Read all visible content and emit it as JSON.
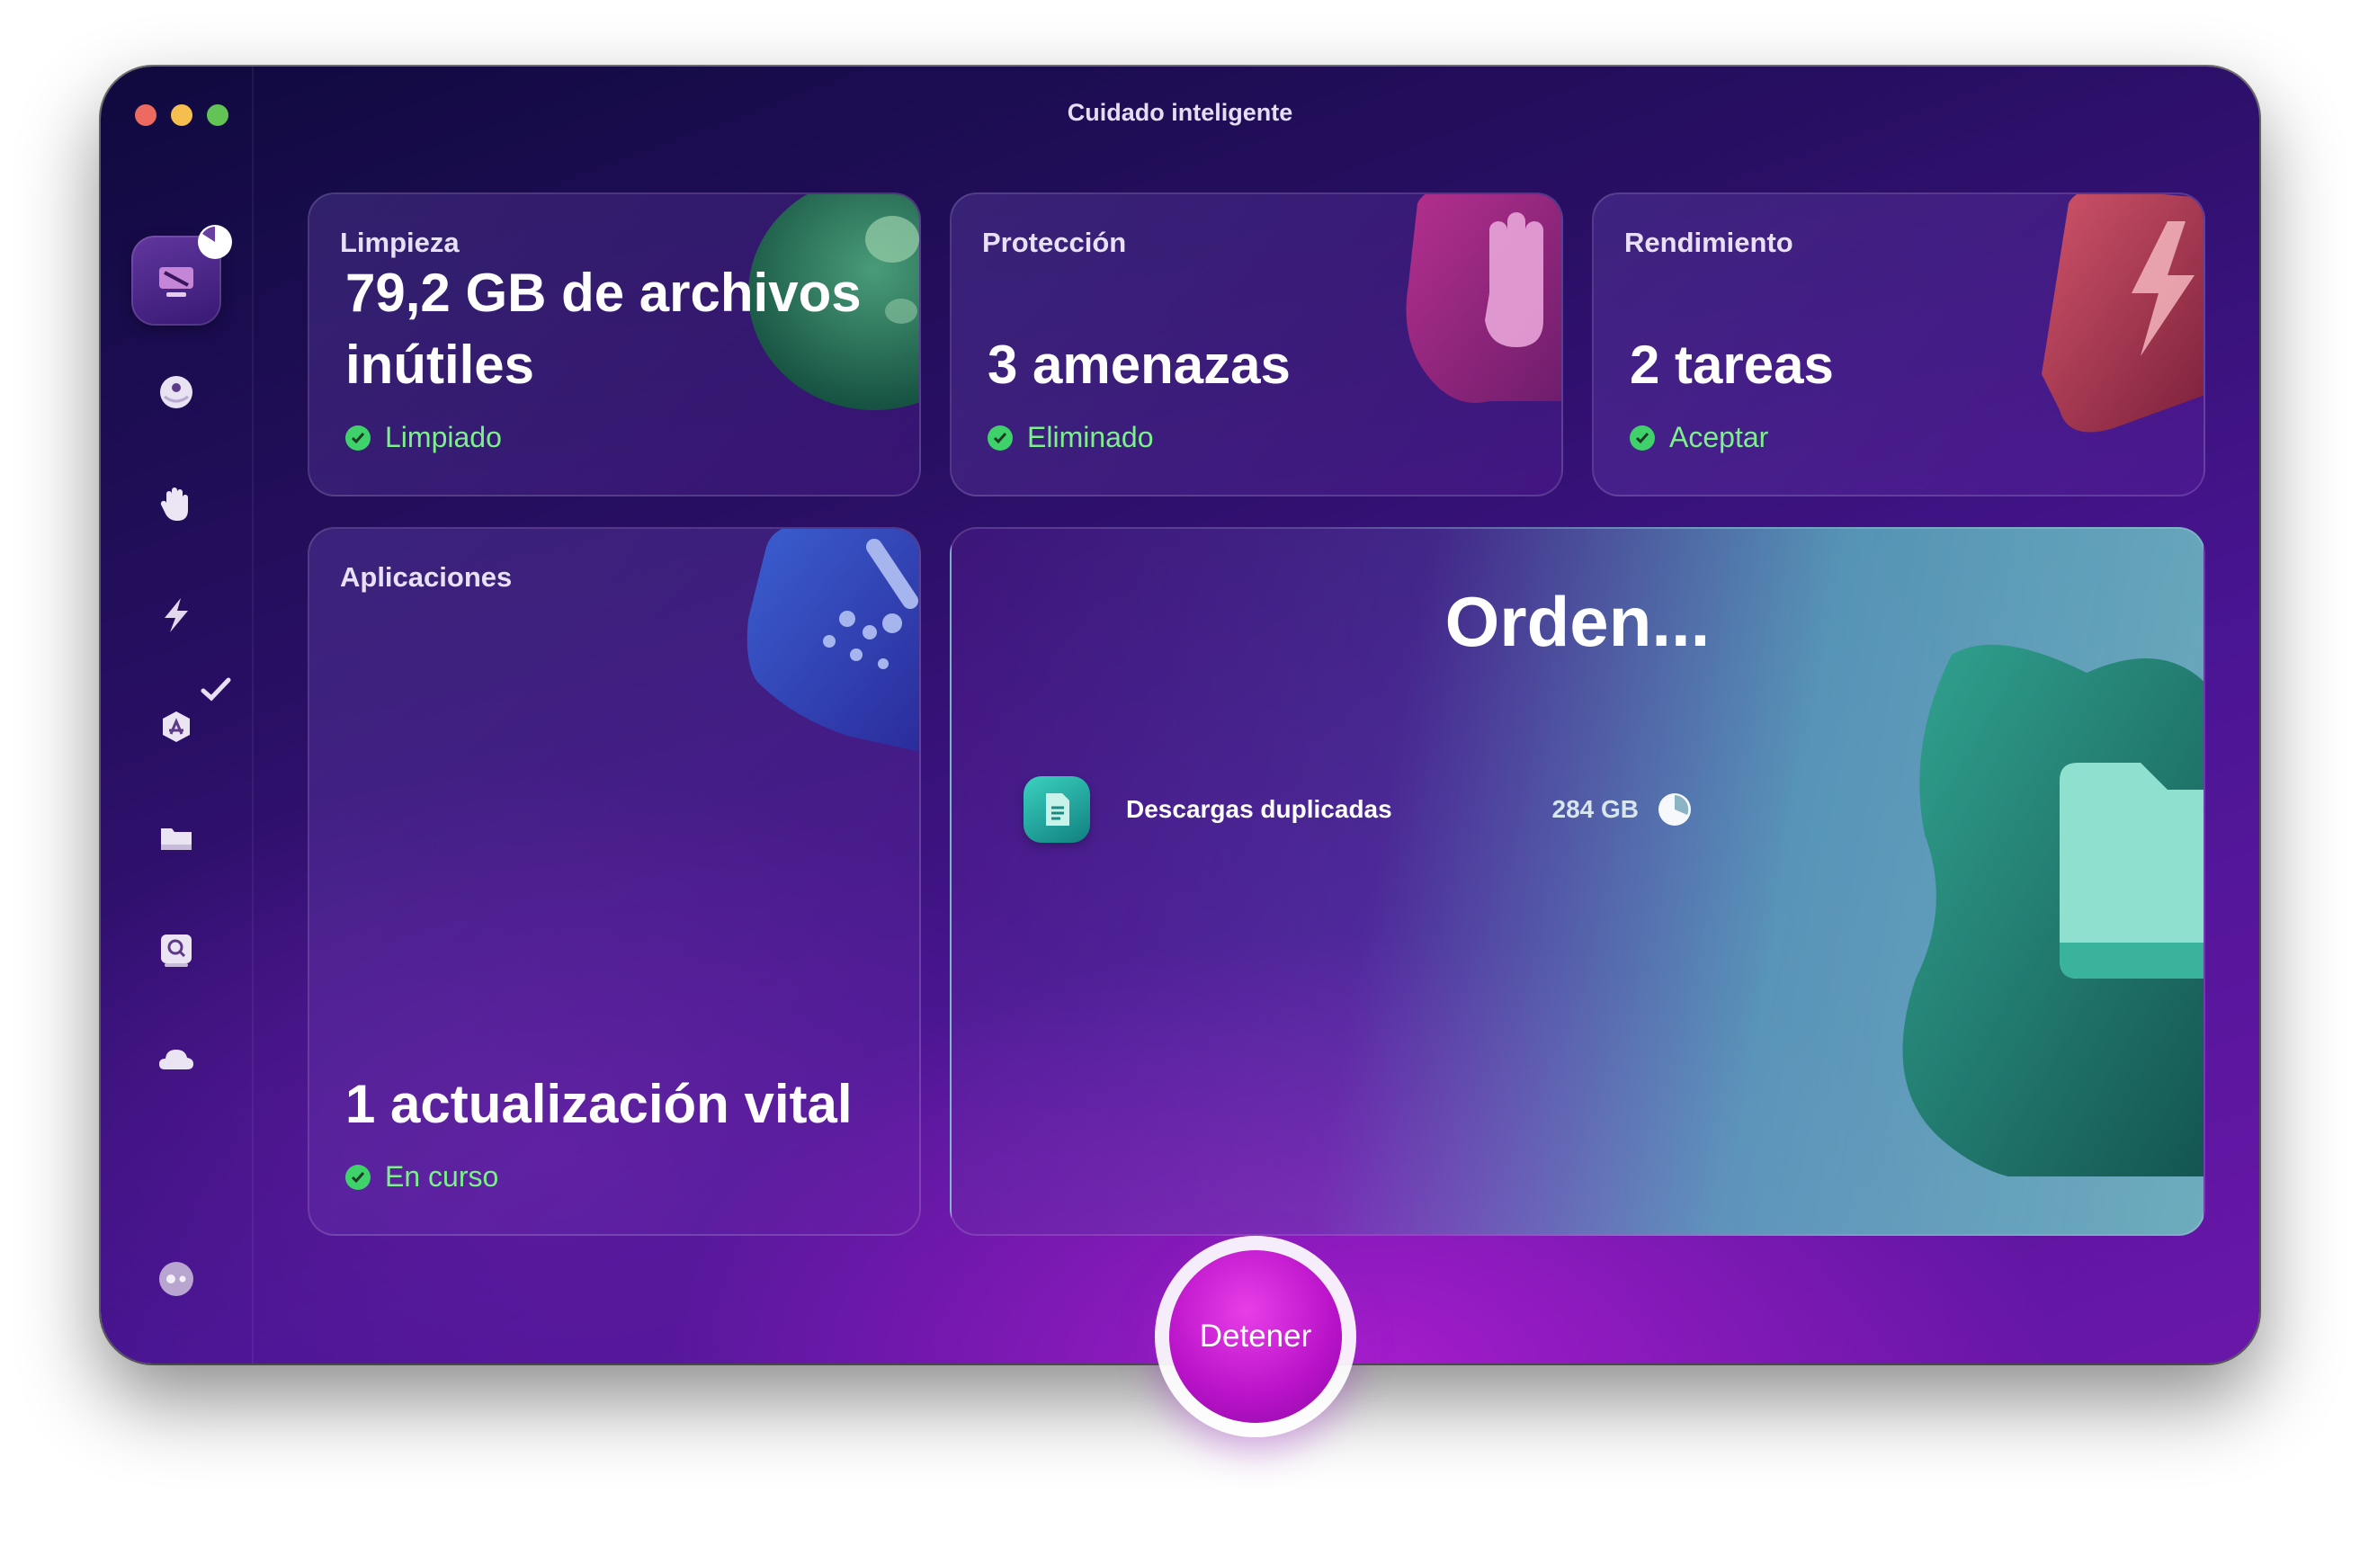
{
  "window": {
    "title": "Cuidado inteligente"
  },
  "sidebar": {
    "items": [
      {
        "name": "smart-care",
        "icon": "monitor-icon",
        "active": true
      },
      {
        "name": "cleanup",
        "icon": "disc-icon"
      },
      {
        "name": "protection",
        "icon": "hand-icon"
      },
      {
        "name": "performance",
        "icon": "lightning-icon"
      },
      {
        "name": "applications",
        "icon": "app-store-icon"
      },
      {
        "name": "my-clutter",
        "icon": "folder-icon"
      },
      {
        "name": "space-lens",
        "icon": "magnifier-icon"
      },
      {
        "name": "cloud",
        "icon": "cloud-icon"
      }
    ],
    "footer_icon": "assistant-icon"
  },
  "cards": {
    "limpieza": {
      "label": "Limpieza",
      "value_line1": "79,2 GB de archivos",
      "value_line2": "inútiles",
      "status": "Limpiado"
    },
    "proteccion": {
      "label": "Protección",
      "value": "3 amenazas",
      "status": "Eliminado"
    },
    "rendimiento": {
      "label": "Rendimiento",
      "value": "2 tareas",
      "status": "Aceptar"
    },
    "aplicaciones": {
      "label": "Aplicaciones",
      "value": "1 actualización vital",
      "status": "En curso"
    }
  },
  "orden": {
    "title": "Orden...",
    "items": [
      {
        "name": "Descargas duplicadas",
        "size": "284 GB"
      }
    ]
  },
  "stop_button": {
    "label": "Detener"
  },
  "colors": {
    "status_green": "#7cf08a",
    "accent_magenta": "#c41ad6",
    "window_dark": "#0f0a3e"
  }
}
